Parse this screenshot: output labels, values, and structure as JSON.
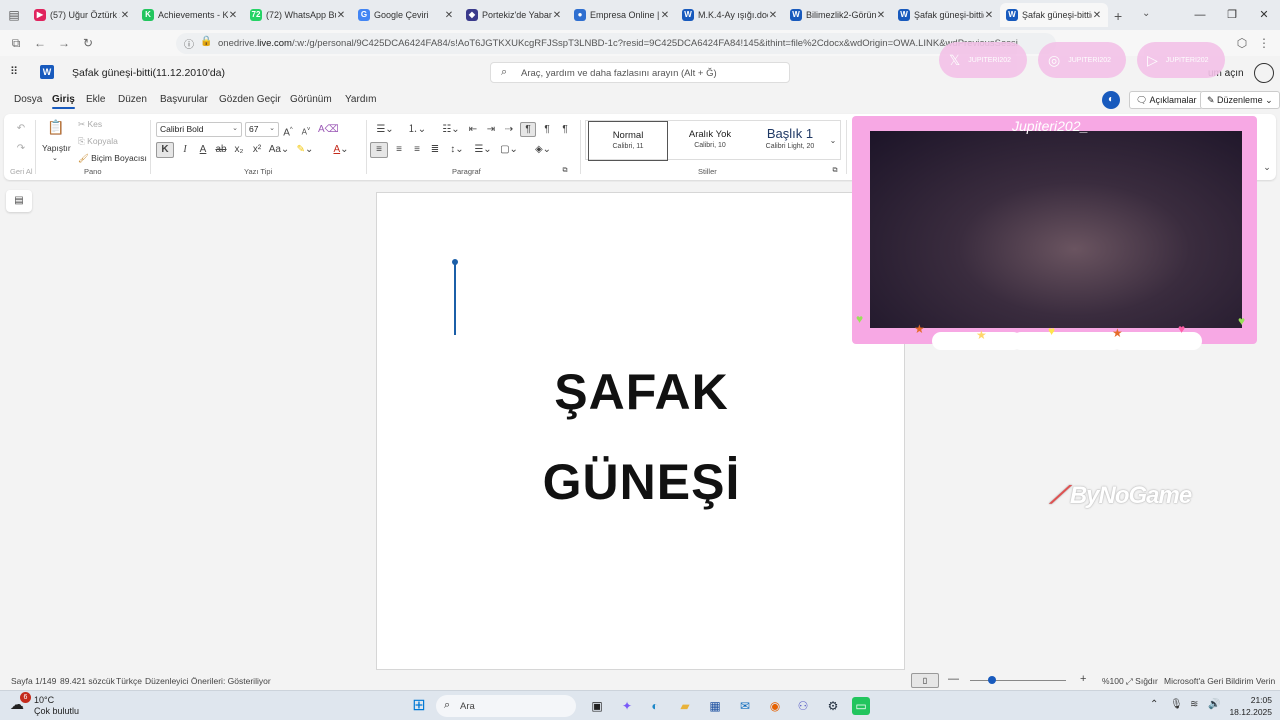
{
  "browser": {
    "tabs": [
      {
        "title": "(57) Uğur Öztürk x ",
        "color": "#e0245e",
        "icon": "youtube-icon",
        "glyph": "▶"
      },
      {
        "title": "Achievements - Kick",
        "color": "#22c55e",
        "icon": "kick-icon",
        "glyph": "K"
      },
      {
        "title": "(72) WhatsApp Busin",
        "color": "#25d366",
        "icon": "whatsapp-icon",
        "glyph": "72"
      },
      {
        "title": "Google Çeviri",
        "color": "#4285f4",
        "icon": "google-translate-icon",
        "glyph": "G"
      },
      {
        "title": "Portekiz'de Yabancı",
        "color": "#3a3a8c",
        "icon": "diamond-icon",
        "glyph": "◆"
      },
      {
        "title": "Empresa Online | Se",
        "color": "#2f6fd0",
        "icon": "globe-icon",
        "glyph": "●"
      },
      {
        "title": "M.K.4-Ay ışığı.docx",
        "color": "#185abd",
        "icon": "word-icon",
        "glyph": "W"
      },
      {
        "title": "Bilimezlik2-Görünm",
        "color": "#185abd",
        "icon": "word-icon",
        "glyph": "W"
      },
      {
        "title": "Şafak güneşi-bitti(1",
        "color": "#185abd",
        "icon": "word-icon",
        "glyph": "W"
      },
      {
        "title": "Şafak güneşi-bitti(1",
        "color": "#185abd",
        "icon": "word-icon",
        "glyph": "W"
      }
    ],
    "active_tab": 9,
    "url_prefix": "onedrive.",
    "url_domain": "live.com",
    "url_rest": "/:w:/g/personal/9C425DCA6424FA84/s!AoT6JGTKXUKcgRFJSspT3LNBD-1c?resid=9C425DCA6424FA84!145&ithint=file%2Cdocx&wdOrigin=OWA.LINK&wdPreviousSession=9336B-ec-6cf2"
  },
  "word": {
    "doc_title": "Şafak güneşi-bitti(11.12.2010'da)",
    "search_placeholder": "Araç, yardım ve daha fazlasını arayın (Alt + Ğ)",
    "account_text": "um açın",
    "menu": [
      "Dosya",
      "Giriş",
      "Ekle",
      "Düzen",
      "Başvurular",
      "Gözden Geçir",
      "Görünüm",
      "Yardım"
    ],
    "active_menu": 1,
    "comments_label": "Açıklamalar",
    "editing_label": "Düzenleme",
    "ribbon": {
      "undo_label": "Geri Al",
      "paste_label": "Yapıştır",
      "cut_label": "Kes",
      "copy_label": "Kopyala",
      "format_painter_label": "Biçim Boyacısı",
      "clipboard_group": "Pano",
      "font_name": "Calibri Bold",
      "font_size": "67",
      "font_group": "Yazı Tipi",
      "paragraph_group": "Paragraf",
      "styles_group": "Stiller",
      "styles": [
        {
          "name": "Normal",
          "desc": "Calibri, 11"
        },
        {
          "name": "Aralık Yok",
          "desc": "Calibri, 10"
        },
        {
          "name": "Başlık 1",
          "desc": "Calibri Light, 20"
        }
      ],
      "colors": {
        "highlight": "#f2c500",
        "font_color": "#c42b1c"
      }
    },
    "document": {
      "line1": "ŞAFAK",
      "line2": "GÜNEŞİ"
    },
    "status": {
      "page": "Sayfa 1/149",
      "words": "89.421 sözcük",
      "language": "Türkçe",
      "editor": "Düzenleyici Önerileri: Gösteriliyor",
      "zoom": "%100",
      "fit": "Sığdır",
      "feedback": "Microsoft'a Geri Bildirim Verin"
    }
  },
  "overlay": {
    "social_handles": [
      "JUPITERI202",
      "JUPITERI202",
      "JUPITERI202"
    ],
    "webcam_caption": "Jupiteri202_",
    "watermark": "ByNoGame"
  },
  "taskbar": {
    "weather_badge": "6",
    "temperature": "10°C",
    "condition": "Çok bulutlu",
    "search_label": "Ara",
    "time": "21:05",
    "date": "18.12.2025"
  }
}
